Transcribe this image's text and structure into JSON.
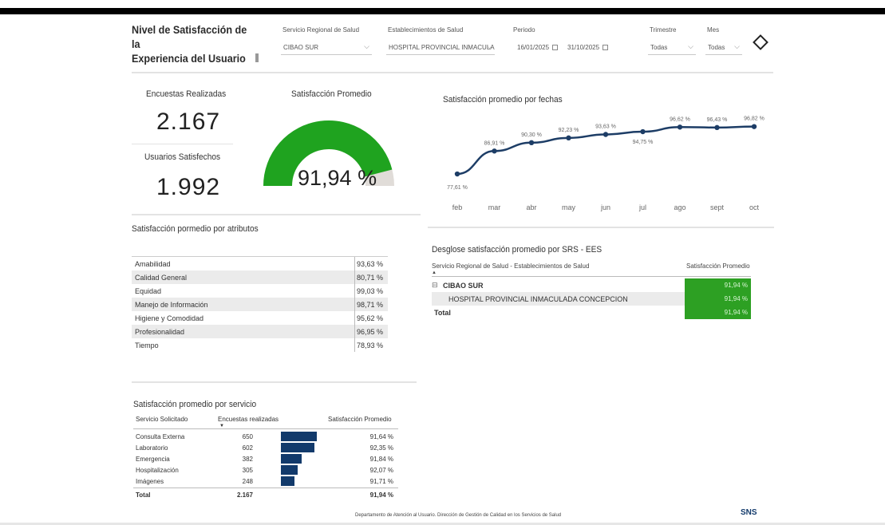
{
  "header": {
    "title_line1": "Nivel de Satisfacción de la",
    "title_line2": "Experiencia del Usuario"
  },
  "filters": {
    "srs": {
      "label": "Servicio Regional de Salud",
      "value": "CIBAO SUR"
    },
    "ees": {
      "label": "Establecimientos de Salud",
      "value": "HOSPITAL PROVINCIAL INMACULA..."
    },
    "periodo": {
      "label": "Periodo",
      "start": "16/01/2025",
      "end": "31/10/2025"
    },
    "trimestre": {
      "label": "Trimestre",
      "value": "Todas"
    },
    "mes": {
      "label": "Mes",
      "value": "Todas"
    }
  },
  "kpis": {
    "encuestas_label": "Encuestas Realizadas",
    "encuestas_value": "2.167",
    "usuarios_label": "Usuarios Satisfechos",
    "usuarios_value": "1.992"
  },
  "gauge": {
    "title": "Satisfacción Promedio",
    "value_text": "91,94 %",
    "value": 91.94,
    "fill_color": "#1fa31f",
    "track_color": "#e0dcd8"
  },
  "line_chart_title": "Satisfacción promedio por fechas",
  "chart_data": {
    "type": "line",
    "categories": [
      "feb",
      "mar",
      "abr",
      "may",
      "jun",
      "jul",
      "ago",
      "sept",
      "oct"
    ],
    "values": [
      77.61,
      86.91,
      90.3,
      92.23,
      93.63,
      94.75,
      96.62,
      96.43,
      96.82
    ],
    "labels": [
      "77,61 %",
      "86,91 %",
      "90,30 %",
      "92,23 %",
      "93,63 %",
      "94,75 %",
      "96,62 %",
      "96,43 %",
      "96,82 %"
    ],
    "title": "Satisfacción promedio por fechas",
    "color": "#1d3d66"
  },
  "attributes": {
    "title": "Satisfacción pormedio por atributos",
    "rows": [
      {
        "name": "Amabilidad",
        "value": "93,63 %"
      },
      {
        "name": "Calidad General",
        "value": "80,71 %"
      },
      {
        "name": "Equidad",
        "value": "99,03 %"
      },
      {
        "name": "Manejo de Información",
        "value": "98,71 %"
      },
      {
        "name": "Higiene y Comodidad",
        "value": "95,62 %"
      },
      {
        "name": "Profesionalidad",
        "value": "96,95 %"
      },
      {
        "name": "Tiempo",
        "value": "78,93 %"
      }
    ]
  },
  "srs_table": {
    "title": "Desglose satisfacción promedio por SRS - EES",
    "col1": "Servicio Regional de Salud - Establecimientos de Salud",
    "col2": "Satisfacción Promedio",
    "group": "CIBAO SUR",
    "group_value": "91,94 %",
    "child": "HOSPITAL PROVINCIAL INMACULADA CONCEPCION",
    "child_value": "91,94 %",
    "total_label": "Total",
    "total_value": "91,94 %",
    "expand_glyph": "⊟"
  },
  "service_table": {
    "title": "Satisfacción promedio por servicio",
    "col1": "Servicio Solicitado",
    "col2": "Encuestas realizadas",
    "col3": "Satisfacción Promedio",
    "rows": [
      {
        "name": "Consulta Externa",
        "count": "650",
        "count_value": 650,
        "sat": "91,64 %"
      },
      {
        "name": "Laboratorio",
        "count": "602",
        "count_value": 602,
        "sat": "92,35 %"
      },
      {
        "name": "Emergencia",
        "count": "382",
        "count_value": 382,
        "sat": "91,84 %"
      },
      {
        "name": "Hospitalización",
        "count": "305",
        "count_value": 305,
        "sat": "92,07 %"
      },
      {
        "name": "Imágenes",
        "count": "248",
        "count_value": 248,
        "sat": "91,71 %"
      }
    ],
    "total_label": "Total",
    "total_count": "2.167",
    "total_sat": "91,94 %"
  },
  "footer": {
    "text": "Departamento de Atención al Usuario. Dirección de Gestión de Calidad en los Servicios de Salud",
    "logo": "SNS"
  }
}
